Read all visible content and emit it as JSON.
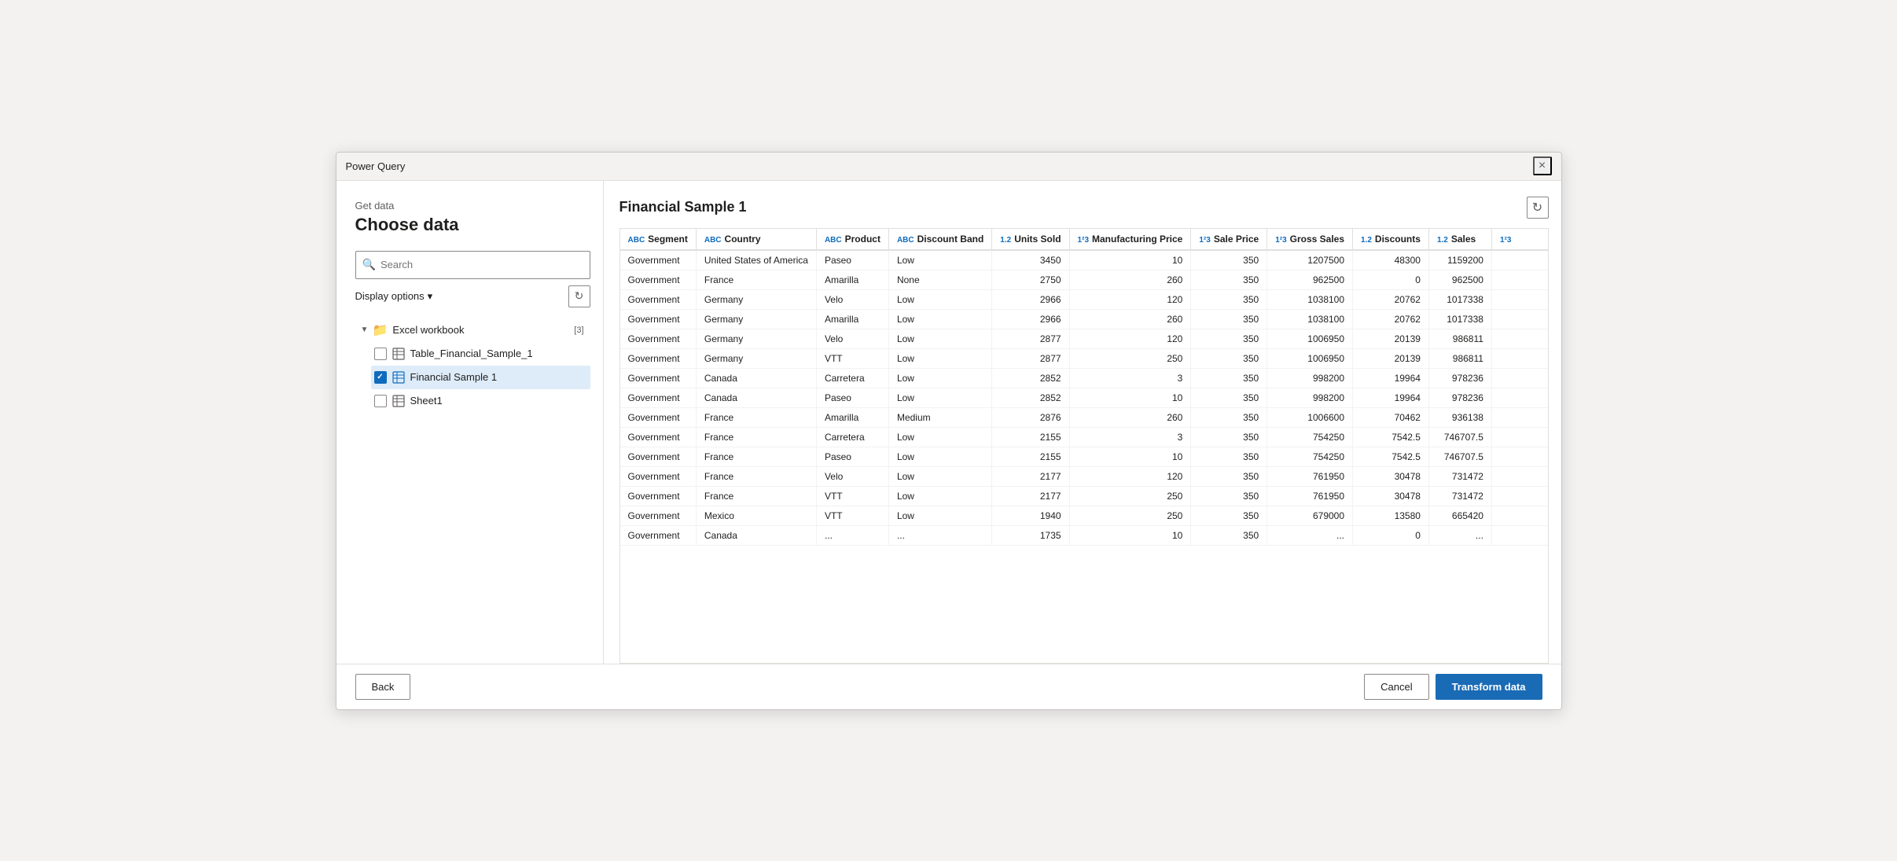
{
  "window": {
    "title": "Power Query",
    "close_label": "×"
  },
  "sidebar": {
    "get_data_label": "Get data",
    "choose_data_title": "Choose data",
    "search_placeholder": "Search",
    "search_label": "Search",
    "display_options_label": "Display options",
    "chevron_down": "▾",
    "tree": {
      "root": {
        "label": "Excel workbook",
        "badge": "[3]",
        "expanded": true,
        "children": [
          {
            "id": "table_financial",
            "label": "Table_Financial_Sample_1",
            "checked": false,
            "selected": false
          },
          {
            "id": "financial_sample_1",
            "label": "Financial Sample 1",
            "checked": true,
            "selected": true
          },
          {
            "id": "sheet1",
            "label": "Sheet1",
            "checked": false,
            "selected": false
          }
        ]
      }
    }
  },
  "preview": {
    "title": "Financial Sample 1",
    "columns": [
      {
        "type": "ABC",
        "label": "Segment"
      },
      {
        "type": "ABC",
        "label": "Country"
      },
      {
        "type": "ABC",
        "label": "Product"
      },
      {
        "type": "ABC",
        "label": "Discount Band"
      },
      {
        "type": "1.2",
        "label": "Units Sold"
      },
      {
        "type": "123",
        "label": "Manufacturing Price"
      },
      {
        "type": "123",
        "label": "Sale Price"
      },
      {
        "type": "123",
        "label": "Gross Sales"
      },
      {
        "type": "1.2",
        "label": "Discounts"
      },
      {
        "type": "1.2",
        "label": "Sales"
      },
      {
        "type": "123",
        "label": "..."
      }
    ],
    "rows": [
      [
        "Government",
        "United States of America",
        "Paseo",
        "Low",
        "3450",
        "10",
        "350",
        "1207500",
        "48300",
        "1159200"
      ],
      [
        "Government",
        "France",
        "Amarilla",
        "None",
        "2750",
        "260",
        "350",
        "962500",
        "0",
        "962500"
      ],
      [
        "Government",
        "Germany",
        "Velo",
        "Low",
        "2966",
        "120",
        "350",
        "1038100",
        "20762",
        "1017338"
      ],
      [
        "Government",
        "Germany",
        "Amarilla",
        "Low",
        "2966",
        "260",
        "350",
        "1038100",
        "20762",
        "1017338"
      ],
      [
        "Government",
        "Germany",
        "Velo",
        "Low",
        "2877",
        "120",
        "350",
        "1006950",
        "20139",
        "986811"
      ],
      [
        "Government",
        "Germany",
        "VTT",
        "Low",
        "2877",
        "250",
        "350",
        "1006950",
        "20139",
        "986811"
      ],
      [
        "Government",
        "Canada",
        "Carretera",
        "Low",
        "2852",
        "3",
        "350",
        "998200",
        "19964",
        "978236"
      ],
      [
        "Government",
        "Canada",
        "Paseo",
        "Low",
        "2852",
        "10",
        "350",
        "998200",
        "19964",
        "978236"
      ],
      [
        "Government",
        "France",
        "Amarilla",
        "Medium",
        "2876",
        "260",
        "350",
        "1006600",
        "70462",
        "936138"
      ],
      [
        "Government",
        "France",
        "Carretera",
        "Low",
        "2155",
        "3",
        "350",
        "754250",
        "7542.5",
        "746707.5"
      ],
      [
        "Government",
        "France",
        "Paseo",
        "Low",
        "2155",
        "10",
        "350",
        "754250",
        "7542.5",
        "746707.5"
      ],
      [
        "Government",
        "France",
        "Velo",
        "Low",
        "2177",
        "120",
        "350",
        "761950",
        "30478",
        "731472"
      ],
      [
        "Government",
        "France",
        "VTT",
        "Low",
        "2177",
        "250",
        "350",
        "761950",
        "30478",
        "731472"
      ],
      [
        "Government",
        "Mexico",
        "VTT",
        "Low",
        "1940",
        "250",
        "350",
        "679000",
        "13580",
        "665420"
      ],
      [
        "Government",
        "Canada",
        "...",
        "...",
        "1735",
        "10",
        "350",
        "...",
        "0",
        "..."
      ]
    ]
  },
  "footer": {
    "back_label": "Back",
    "cancel_label": "Cancel",
    "transform_label": "Transform data"
  }
}
